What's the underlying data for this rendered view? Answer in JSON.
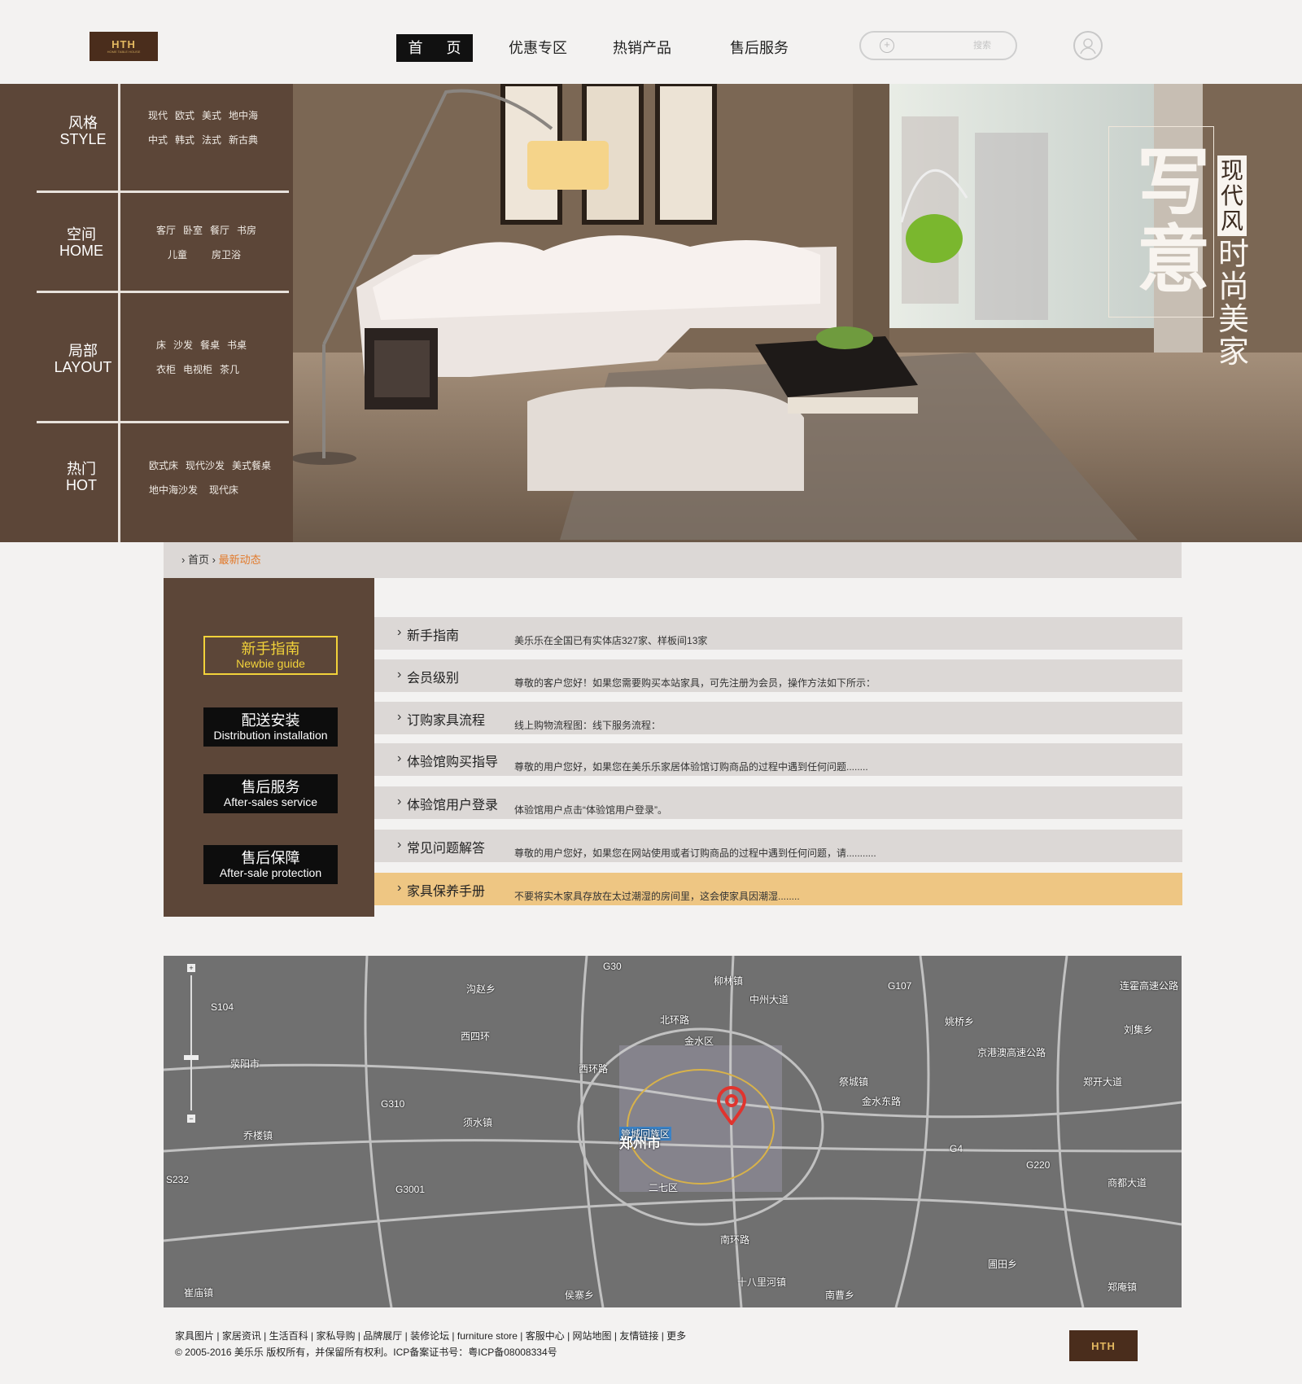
{
  "header": {
    "logo_text": "HTH",
    "logo_sub": "HOME TABLE HOUSE",
    "nav": [
      {
        "label": "首 页"
      },
      {
        "label": "优惠专区"
      },
      {
        "label": "热销产品"
      },
      {
        "label": "售后服务"
      }
    ],
    "search_placeholder": "搜索"
  },
  "banner": {
    "categories": [
      {
        "zh": "风格",
        "en": "STYLE",
        "rows": [
          [
            "现代",
            "欧式",
            "美式",
            "地中海"
          ],
          [
            "中式",
            "韩式",
            "法式",
            "新古典"
          ]
        ]
      },
      {
        "zh": "空间",
        "en": "HOME",
        "rows": [
          [
            "客厅",
            "卧室",
            "餐厅",
            "书房"
          ],
          [
            "儿童",
            "房卫浴"
          ]
        ]
      },
      {
        "zh": "局部",
        "en": "LAYOUT",
        "rows": [
          [
            "床",
            "沙发",
            "餐桌",
            "书桌"
          ],
          [
            "衣柜",
            "电视柜",
            "茶几"
          ]
        ]
      },
      {
        "zh": "热门",
        "en": "HOT",
        "rows": [
          [
            "欧式床",
            "现代沙发",
            "美式餐桌"
          ],
          [
            "地中海沙发",
            "现代床"
          ]
        ]
      }
    ],
    "slogan": {
      "big1": "写",
      "big2": "意",
      "tag": "现代风",
      "line": "时尚美家"
    }
  },
  "breadcrumb": {
    "home": "首页",
    "current": "最新动态"
  },
  "sidebar": [
    {
      "zh": "新手指南",
      "en": "Newbie guide"
    },
    {
      "zh": "配送安装",
      "en": "Distribution installation"
    },
    {
      "zh": "售后服务",
      "en": "After-sales service"
    },
    {
      "zh": "售后保障",
      "en": "After-sale protection"
    }
  ],
  "faq": [
    {
      "q": "新手指南",
      "a": "美乐乐在全国已有实体店327家、样板间13家"
    },
    {
      "q": "会员级别",
      "a": "尊敬的客户您好！如果您需要购买本站家具，可先注册为会员，操作方法如下所示："
    },
    {
      "q": "订购家具流程",
      "a": "线上购物流程图：线下服务流程："
    },
    {
      "q": "体验馆购买指导",
      "a": "尊敬的用户您好，如果您在美乐乐家居体验馆订购商品的过程中遇到任何问题........"
    },
    {
      "q": "体验馆用户登录",
      "a": "体验馆用户点击“体验馆用户登录”。"
    },
    {
      "q": "常见问题解答",
      "a": "尊敬的用户您好，如果您在网站使用或者订购商品的过程中遇到任何问题，请..........."
    },
    {
      "q": "家具保养手册",
      "a": "不要将实木家具存放在太过潮湿的房间里，这会使家具因潮湿........"
    }
  ],
  "map": {
    "labels": [
      "沟赵乡",
      "柳林镇",
      "G30",
      "G107",
      "S104",
      "北环路",
      "金水区",
      "中州大道",
      "姚桥乡",
      "刘集乡",
      "荥阳市",
      "西四环",
      "西环路",
      "郑开大道",
      "祭城镇",
      "金水东路",
      "G310",
      "须水镇",
      "管城回族区",
      "郑州市",
      "乔楼镇",
      "二七区",
      "G4",
      "G220",
      "S232",
      "G3001",
      "南环路",
      "圃田乡",
      "崔庙镇",
      "十八里河镇",
      "南曹乡",
      "侯寨乡",
      "郑庵镇",
      "连霍高速公路",
      "京港澳高速公路",
      "商都大道"
    ],
    "marker_label": "管城回族区"
  },
  "footer": {
    "links": [
      "家具图片",
      "家居资讯",
      "生活百科",
      "家私导购",
      "品牌展厅",
      "装修论坛",
      "furniture store",
      "客服中心",
      "网站地图",
      "友情链接",
      "更多"
    ],
    "copyright": "© 2005-2016 美乐乐 版权所有，并保留所有权利。ICP备案证书号：粤ICP备08008334号",
    "logo_text": "HTH"
  }
}
